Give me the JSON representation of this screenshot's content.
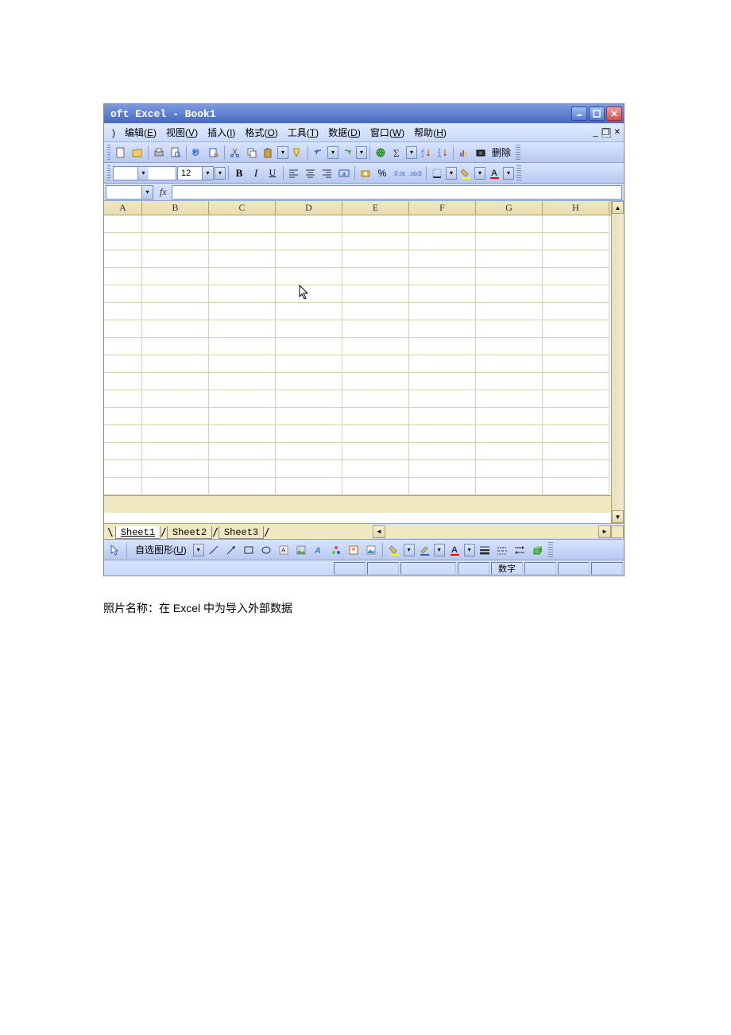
{
  "title": "oft Excel - Book1",
  "menu": {
    "file_partial": ")",
    "edit": "编辑",
    "edit_hk": "E",
    "view": "视图",
    "view_hk": "V",
    "insert": "插入",
    "insert_hk": "I",
    "format": "格式",
    "format_hk": "O",
    "tools": "工具",
    "tools_hk": "T",
    "data": "数据",
    "data_hk": "D",
    "window": "窗口",
    "window_hk": "W",
    "help": "帮助",
    "help_hk": "H"
  },
  "standard_toolbar": {
    "delete_label": "删除"
  },
  "format_toolbar": {
    "font_size": "12"
  },
  "formulabar": {
    "namebox": "",
    "fx": "fx",
    "formula": ""
  },
  "columns": [
    "A",
    "B",
    "C",
    "D",
    "E",
    "F",
    "G",
    "H"
  ],
  "sheets": [
    "Sheet1",
    "Sheet2",
    "Sheet3"
  ],
  "active_sheet_index": 0,
  "drawing_toolbar": {
    "autoshapes": "自选图形",
    "autoshapes_hk": "U"
  },
  "statusbar": {
    "num": "数字"
  },
  "caption": "照片名称：在 Excel 中为导入外部数据"
}
